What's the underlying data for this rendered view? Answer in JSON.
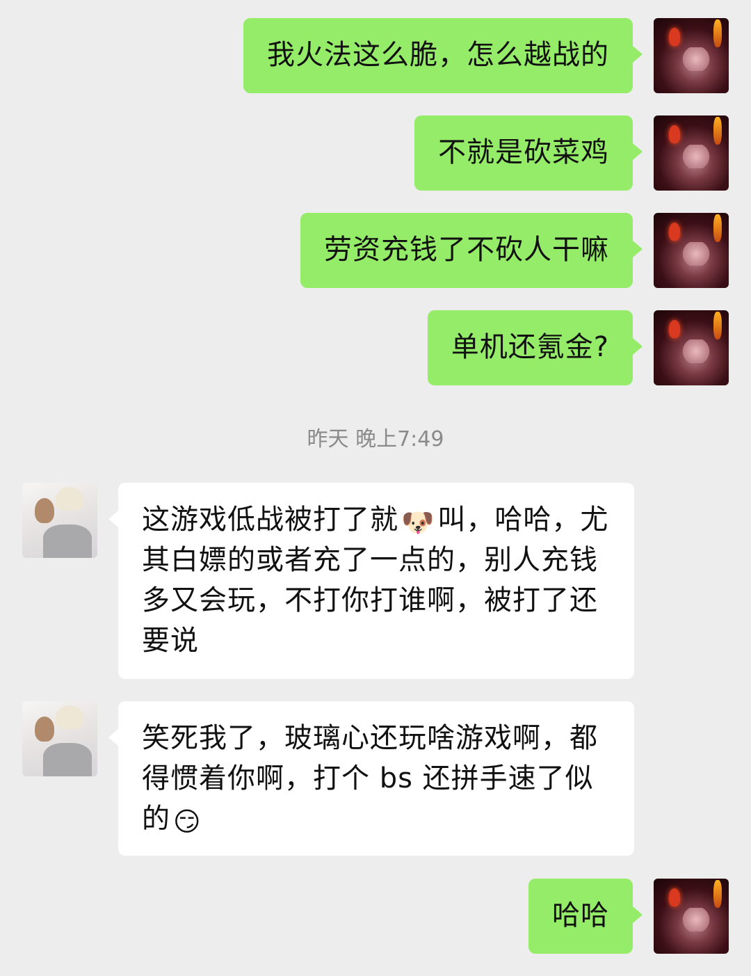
{
  "messages": [
    {
      "side": "right",
      "text": "我火法这么脆，怎么越战的"
    },
    {
      "side": "right",
      "text": "不就是砍菜鸡"
    },
    {
      "side": "right",
      "text": "劳资充钱了不砍人干嘛"
    },
    {
      "side": "right",
      "text": "单机还氪金?"
    },
    {
      "side": "left",
      "text_before_emoji": "这游戏低战被打了就",
      "emoji": "🐶",
      "text_after_emoji": "叫，哈哈，尤其白嫖的或者充了一点的，别人充钱多又会玩，不打你打谁啊，被打了还要说"
    },
    {
      "side": "left",
      "text_before_emoji": "笑死我了，玻璃心还玩啥游戏啊，都得惯着你啊，打个 bs 还拼手速了似的",
      "emoji": "😏"
    },
    {
      "side": "right",
      "text": "哈哈"
    }
  ],
  "timestamp": "昨天 晚上7:49",
  "colors": {
    "background": "#ededed",
    "self_bubble": "#95ec69",
    "other_bubble": "#ffffff"
  }
}
